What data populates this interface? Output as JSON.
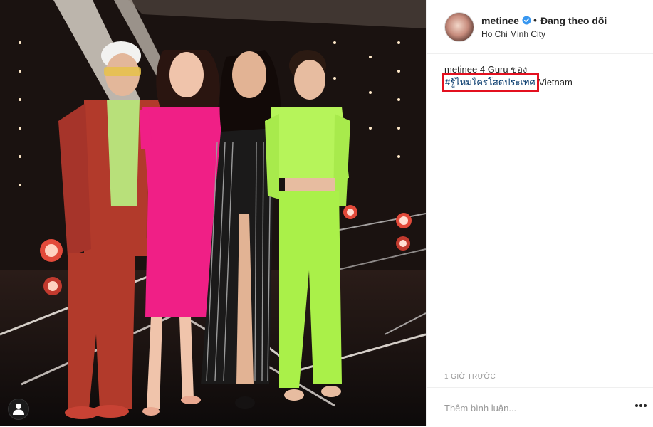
{
  "post": {
    "author": "metinee",
    "follow_state": "Đang theo dõi",
    "separator": "•",
    "location": "Ho Chi Minh City",
    "caption_user": "metinee",
    "caption_text": " 4 Guru ของ",
    "caption_hashtag": "#รู้ไหมใครโสดประเทศ",
    "caption_suffix": " Vietnam",
    "timestamp": "1 GIỜ TRƯỚC",
    "comment_placeholder": "Thêm bình luận..."
  },
  "icons": {
    "verified": "verified-badge-icon",
    "more": "more-options-icon",
    "user_tag": "user-tag-icon"
  },
  "colors": {
    "hashtag": "#003569",
    "highlight_box": "#e3101f",
    "verified": "#3897f0",
    "text": "#262626",
    "muted": "#999999"
  }
}
